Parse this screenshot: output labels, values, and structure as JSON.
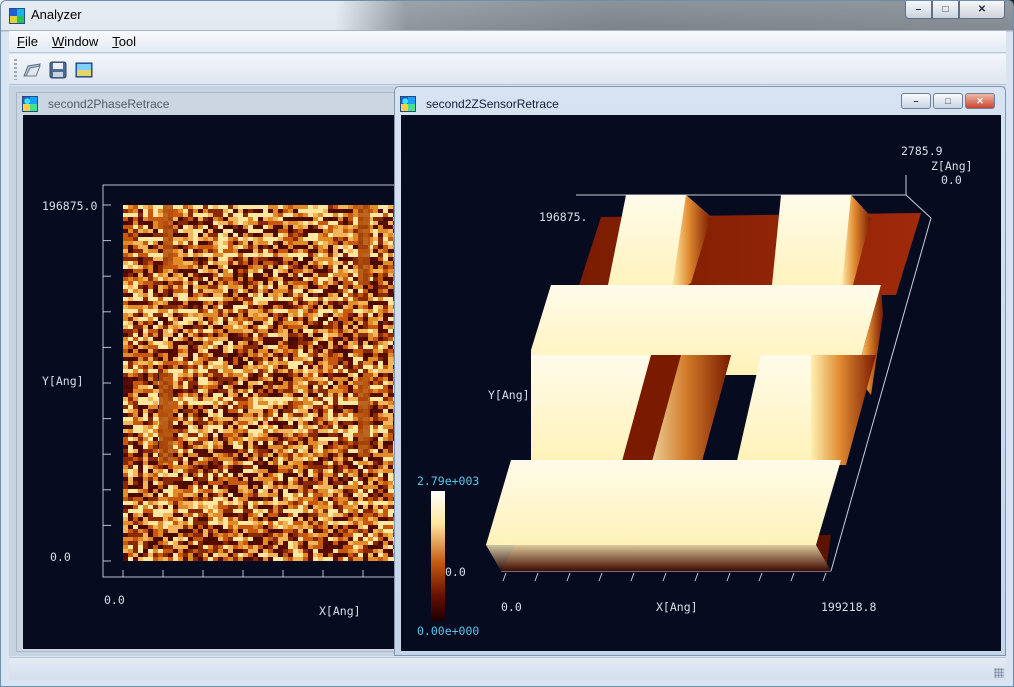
{
  "app": {
    "title": "Analyzer"
  },
  "window_buttons": {
    "minimize": "–",
    "maximize": "□",
    "close": "✕"
  },
  "menu": [
    {
      "accel": "F",
      "rest": "ile"
    },
    {
      "accel": "W",
      "rest": "indow"
    },
    {
      "accel": "T",
      "rest": "ool"
    }
  ],
  "toolbar": {
    "icons": [
      "open-icon",
      "save-icon",
      "image-icon"
    ]
  },
  "windows": {
    "phase": {
      "title": "second2PhaseRetrace",
      "y_top_label": "196875.0",
      "y_bottom_label": "0.0",
      "y_axis_label": "Y[Ang]",
      "x_left_label": "0.0",
      "x_axis_label": "X[Ang]"
    },
    "zsensor": {
      "title": "second2ZSensorRetrace",
      "z_max_label": "2785.9",
      "z_axis_label": "Z[Ang]",
      "z_min_label": "0.0",
      "y_top_label": "196875.",
      "y_axis_label": "Y[Ang]",
      "colorbar_max": "2.79e+003",
      "colorbar_mid": "0.0",
      "colorbar_min": "0.00e+000",
      "x_left_label": "0.0",
      "x_axis_label": "X[Ang]",
      "x_right_label": "199218.8"
    }
  },
  "colors": {
    "plot_bg": "#060b20",
    "heat_dark": "#5a0c00",
    "heat_mid": "#c8580e",
    "heat_light": "#ffe7a0"
  }
}
